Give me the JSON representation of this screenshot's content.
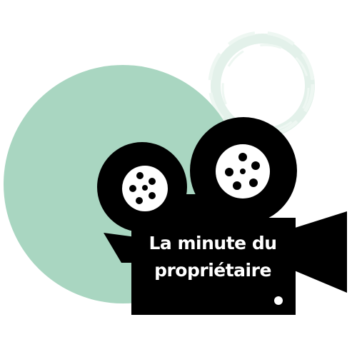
{
  "illustration": {
    "title_line_1": "La minute du",
    "title_line_2": "propriétaire",
    "icon": "film-camera-icon",
    "colors": {
      "camera": "#000000",
      "mint_circle": "#a9d6c1",
      "light_ring": "#e3f1ea",
      "text": "#ffffff",
      "background": "#ffffff"
    }
  }
}
